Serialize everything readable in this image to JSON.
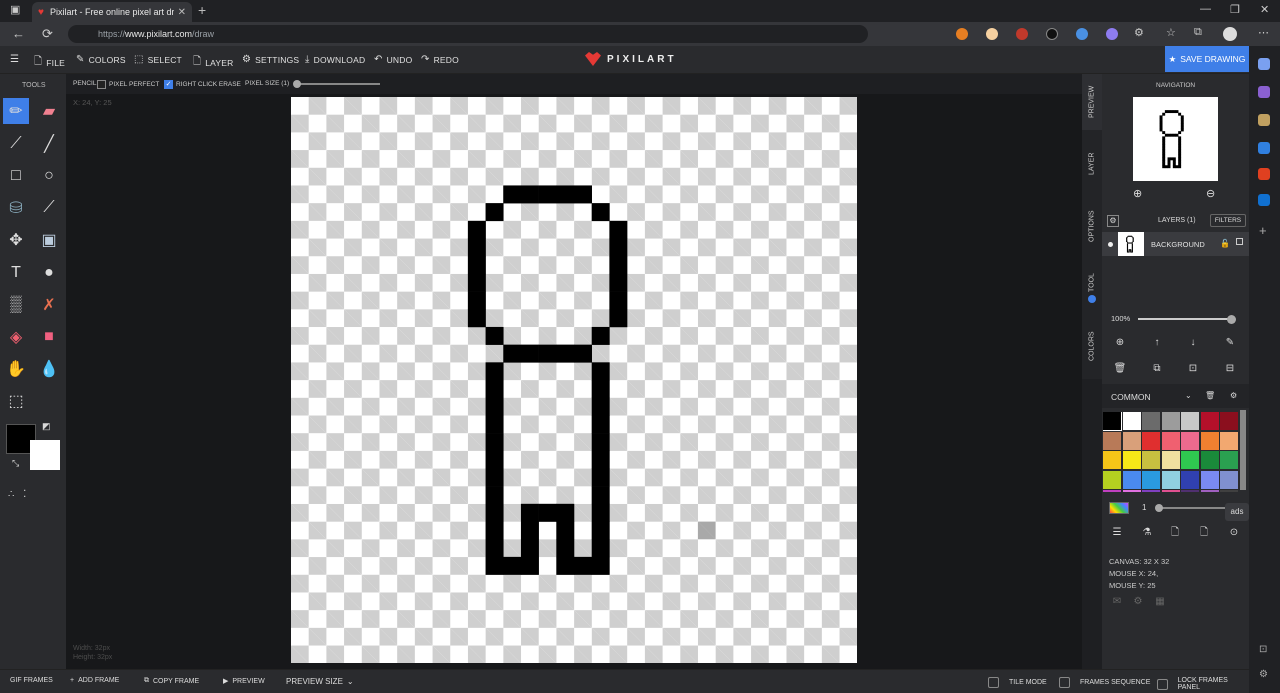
{
  "browser": {
    "tab_title": "Pixilart - Free online pixel art dr",
    "url_prefix": "https://",
    "url_host": "www.pixilart.com",
    "url_path": "/draw"
  },
  "toolbar": {
    "file": "FILE",
    "colors": "COLORS",
    "select": "SELECT",
    "layer": "LAYER",
    "settings": "SETTINGS",
    "download": "DOWNLOAD",
    "undo": "UNDO",
    "redo": "REDO",
    "logo": "PIXILART",
    "save": "SAVE DRAWING"
  },
  "tools": {
    "header": "TOOLS"
  },
  "options": {
    "pencil": "PENCIL:",
    "pixel_perfect": "PIXEL PERFECT",
    "right_click_erase": "RIGHT CLICK ERASE",
    "pixel_size": "PIXEL SIZE (1)"
  },
  "workspace": {
    "coords": "X: 24, Y: 25",
    "width": "Width: 32px",
    "height": "Height: 32px"
  },
  "side_tabs": [
    "PREVIEW",
    "LAYER",
    "OPTIONS",
    "TOOL",
    "COLORS"
  ],
  "panel": {
    "navigation": "NAVIGATION",
    "layers_title": "LAYERS (1)",
    "filters": "FILTERS",
    "layer_name": "BACKGROUND",
    "opacity": "100%",
    "palette_name": "COMMON",
    "brush_count": "1",
    "ads": "ads",
    "canvas_info": "CANVAS: 32 X 32",
    "mouse_x": "MOUSE X: 24,",
    "mouse_y": "MOUSE Y: 25"
  },
  "palette": [
    "#000000",
    "#ffffff",
    "#6b6b6b",
    "#9c9c9c",
    "#c8c8c8",
    "#b5102a",
    "#8b0f1e",
    "#b87a58",
    "#d9a07a",
    "#e02f2f",
    "#f06070",
    "#ec6a8e",
    "#f08030",
    "#f2a870",
    "#f5c518",
    "#f5e818",
    "#c8c040",
    "#f0e0a0",
    "#2fc850",
    "#1a8a3a",
    "#2aa050",
    "#b5d020",
    "#4a8af0",
    "#2a9ae0",
    "#90d0e0",
    "#3040b0",
    "#7a8af0",
    "#8090d0",
    "#c040c0",
    "#e070e0",
    "#8040c0",
    "#e05090",
    "#503070",
    "#a060c0",
    "#404040"
  ],
  "bottom": {
    "gif_frames": "GIF FRAMES",
    "add_frame": "ADD FRAME",
    "copy_frame": "COPY FRAME",
    "preview": "PREVIEW",
    "preview_size": "PREVIEW SIZE",
    "tile_mode": "TILE MODE",
    "frames_sequence": "FRAMES SEQUENCE",
    "lock_frames": "LOCK FRAMES PANEL"
  },
  "drawing": {
    "grid": 32,
    "pixels": [
      [
        12,
        5
      ],
      [
        13,
        5
      ],
      [
        14,
        5
      ],
      [
        15,
        5
      ],
      [
        16,
        5
      ],
      [
        11,
        6
      ],
      [
        17,
        6
      ],
      [
        10,
        7
      ],
      [
        18,
        7
      ],
      [
        10,
        8
      ],
      [
        18,
        8
      ],
      [
        10,
        9
      ],
      [
        18,
        9
      ],
      [
        10,
        10
      ],
      [
        18,
        10
      ],
      [
        10,
        11
      ],
      [
        18,
        11
      ],
      [
        10,
        12
      ],
      [
        18,
        12
      ],
      [
        11,
        13
      ],
      [
        17,
        13
      ],
      [
        12,
        14
      ],
      [
        13,
        14
      ],
      [
        14,
        14
      ],
      [
        15,
        14
      ],
      [
        16,
        14
      ],
      [
        11,
        15
      ],
      [
        17,
        15
      ],
      [
        11,
        16
      ],
      [
        17,
        16
      ],
      [
        11,
        17
      ],
      [
        17,
        17
      ],
      [
        11,
        18
      ],
      [
        17,
        18
      ],
      [
        11,
        19
      ],
      [
        17,
        19
      ],
      [
        11,
        20
      ],
      [
        17,
        20
      ],
      [
        11,
        21
      ],
      [
        17,
        21
      ],
      [
        11,
        22
      ],
      [
        17,
        22
      ],
      [
        11,
        23
      ],
      [
        13,
        23
      ],
      [
        14,
        23
      ],
      [
        15,
        23
      ],
      [
        17,
        23
      ],
      [
        11,
        24
      ],
      [
        13,
        24
      ],
      [
        15,
        24
      ],
      [
        17,
        24
      ],
      [
        11,
        25
      ],
      [
        13,
        25
      ],
      [
        15,
        25
      ],
      [
        17,
        25
      ],
      [
        11,
        26
      ],
      [
        12,
        26
      ],
      [
        13,
        26
      ],
      [
        15,
        26
      ],
      [
        16,
        26
      ],
      [
        17,
        26
      ]
    ],
    "hover": [
      23,
      24
    ]
  }
}
